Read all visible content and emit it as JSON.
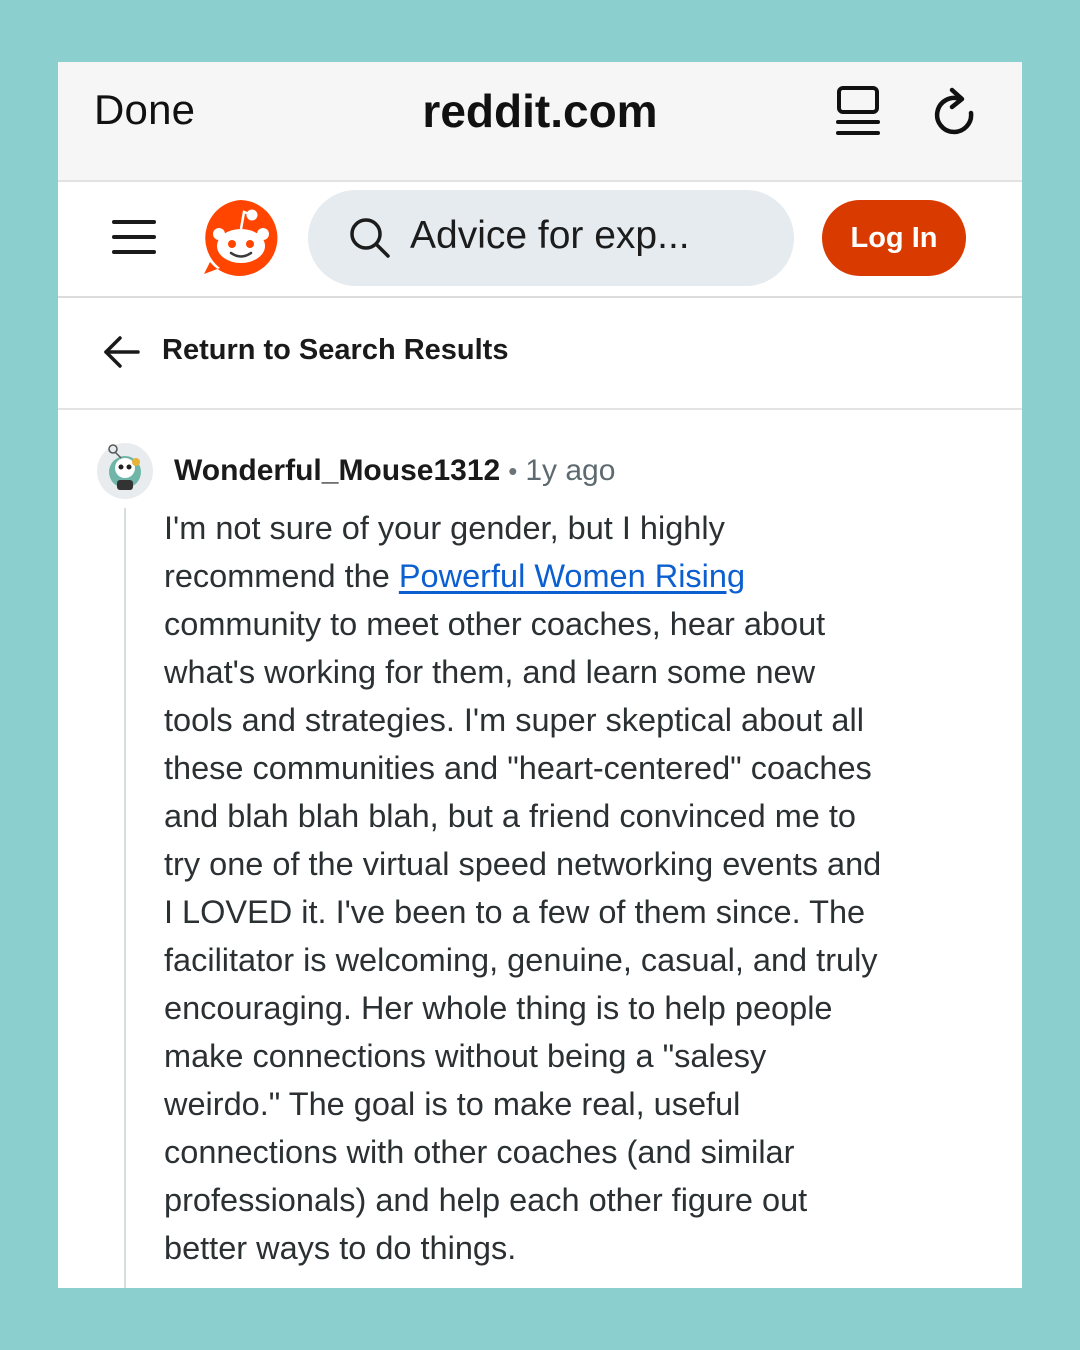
{
  "browser": {
    "done_label": "Done",
    "domain": "reddit.com"
  },
  "header": {
    "search_text": "Advice for exp...",
    "login_label": "Log In"
  },
  "nav": {
    "return_label": "Return to Search Results"
  },
  "comment": {
    "username": "Wonderful_Mouse1312",
    "separator": "•",
    "time": "1y ago",
    "line1": "I'm not sure of your gender, but I highly",
    "line2_pre": "recommend the ",
    "link_text": "Powerful Women Rising",
    "line3": "community to meet other coaches, hear about",
    "line4": "what's working for them, and learn some new",
    "line5": "tools and strategies. I'm super skeptical about all",
    "line6": "these communities and \"heart-centered\" coaches",
    "line7": "and blah blah blah, but a friend convinced me to",
    "line8": "try one of the virtual speed networking events and",
    "line9": "I LOVED it. I've been to a few of them since. The",
    "line10": "facilitator is welcoming, genuine, casual, and truly",
    "line11": "encouraging. Her whole thing is to help people",
    "line12": "make connections without being a \"salesy",
    "line13": "weirdo.\" The goal is to make real, useful",
    "line14": "connections with other coaches (and similar",
    "line15": "professionals) and help each other figure out",
    "line16": "better ways to do things."
  },
  "colors": {
    "background": "#8ccfcf",
    "login_button": "#d93a00",
    "reddit_orange": "#ff4500",
    "link": "#0b5fd1"
  },
  "icons": {
    "reader": "reader-mode-icon",
    "reload": "reload-icon",
    "menu": "hamburger-menu-icon",
    "logo": "reddit-logo-icon",
    "search": "search-icon",
    "back": "back-arrow-icon",
    "avatar": "user-avatar"
  }
}
